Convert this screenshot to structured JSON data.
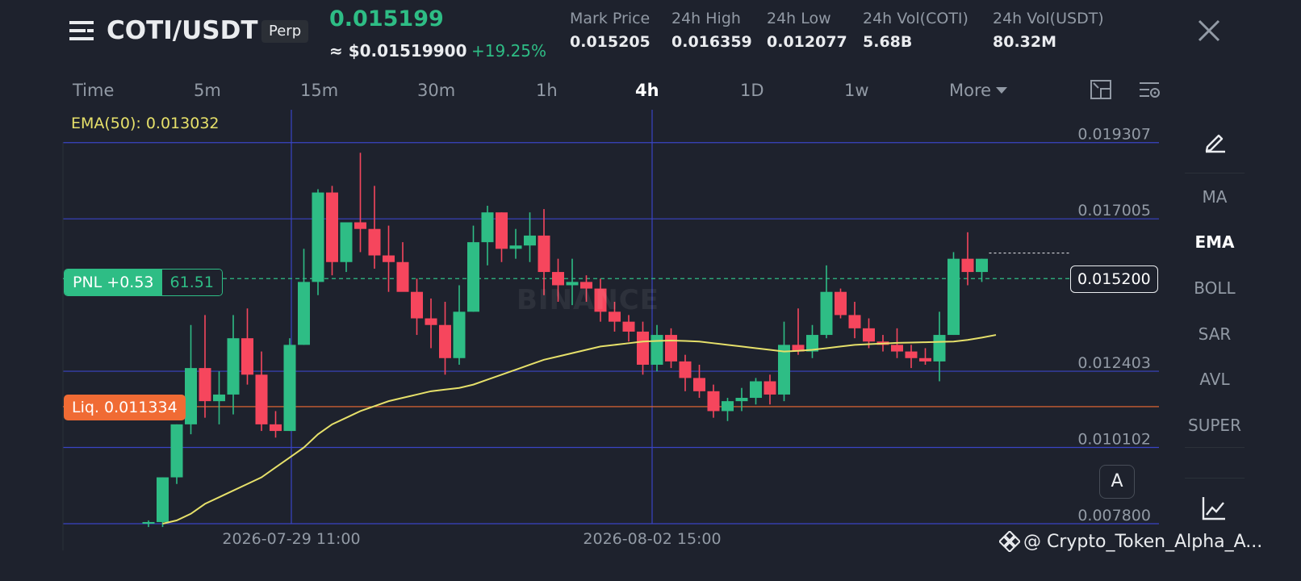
{
  "header": {
    "pair": "COTI/USDT",
    "badge": "Perp",
    "last_price": "0.015199",
    "usd_price": "≈ $0.01519900",
    "change_pct": "+19.25%",
    "stats": [
      {
        "label": "Mark Price",
        "value": "0.015205"
      },
      {
        "label": "24h High",
        "value": "0.016359"
      },
      {
        "label": "24h Low",
        "value": "0.012077"
      },
      {
        "label": "24h Vol(COTI)",
        "value": "5.68B"
      },
      {
        "label": "24h Vol(USDT)",
        "value": "80.32M"
      }
    ]
  },
  "timeframes": [
    "Time",
    "5m",
    "15m",
    "30m",
    "1h",
    "4h",
    "1D",
    "1w",
    "More"
  ],
  "active_timeframe": "4h",
  "indicator_label": "EMA(50): 0.013032",
  "pnl": {
    "label": "PNL +0.53",
    "value": "61.51"
  },
  "liquidation": "Liq. 0.011334",
  "current_price_tag": "0.015200",
  "watermark": "BINANCE",
  "auto_button": "A",
  "side_indicators": [
    "MA",
    "EMA",
    "BOLL",
    "SAR",
    "AVL",
    "SUPER"
  ],
  "active_indicator": "EMA",
  "footer": "@ Crypto_Token_Alpha_A...",
  "colors": {
    "up": "#2ebd85",
    "down": "#f6465d",
    "ema": "#e6e06a",
    "grid": "#3a44c4",
    "liq": "#f06b34",
    "background": "#1e222d"
  },
  "chart_data": {
    "type": "candlestick",
    "y_ticks": [
      "0.019307",
      "0.017005",
      "0.012403",
      "0.010102",
      "0.007800"
    ],
    "x_ticks": [
      "2026-07-29 11:00",
      "2026-08-02 15:00"
    ],
    "ylim": [
      0.0078,
      0.0193
    ],
    "candles": [
      {
        "o": 0.0078,
        "h": 0.0079,
        "l": 0.0077,
        "c": 0.00785
      },
      {
        "o": 0.00785,
        "h": 0.0092,
        "l": 0.0077,
        "c": 0.0092
      },
      {
        "o": 0.0092,
        "h": 0.0108,
        "l": 0.009,
        "c": 0.0108
      },
      {
        "o": 0.0108,
        "h": 0.0138,
        "l": 0.0105,
        "c": 0.0125
      },
      {
        "o": 0.0125,
        "h": 0.0141,
        "l": 0.011,
        "c": 0.0115
      },
      {
        "o": 0.0115,
        "h": 0.0124,
        "l": 0.0108,
        "c": 0.0117
      },
      {
        "o": 0.0117,
        "h": 0.0141,
        "l": 0.0111,
        "c": 0.0134
      },
      {
        "o": 0.0134,
        "h": 0.0143,
        "l": 0.012,
        "c": 0.0123
      },
      {
        "o": 0.0123,
        "h": 0.013,
        "l": 0.0106,
        "c": 0.0108
      },
      {
        "o": 0.0108,
        "h": 0.0112,
        "l": 0.0104,
        "c": 0.0106
      },
      {
        "o": 0.0106,
        "h": 0.0134,
        "l": 0.0106,
        "c": 0.0132
      },
      {
        "o": 0.0132,
        "h": 0.0161,
        "l": 0.0132,
        "c": 0.0151
      },
      {
        "o": 0.0151,
        "h": 0.0179,
        "l": 0.0147,
        "c": 0.0178
      },
      {
        "o": 0.0178,
        "h": 0.018,
        "l": 0.0153,
        "c": 0.0157
      },
      {
        "o": 0.0157,
        "h": 0.0169,
        "l": 0.0154,
        "c": 0.0169
      },
      {
        "o": 0.0169,
        "h": 0.019,
        "l": 0.016,
        "c": 0.0167
      },
      {
        "o": 0.0167,
        "h": 0.018,
        "l": 0.0155,
        "c": 0.0159
      },
      {
        "o": 0.0159,
        "h": 0.0168,
        "l": 0.0148,
        "c": 0.0157
      },
      {
        "o": 0.0157,
        "h": 0.0163,
        "l": 0.0149,
        "c": 0.0148
      },
      {
        "o": 0.0148,
        "h": 0.0152,
        "l": 0.0135,
        "c": 0.014
      },
      {
        "o": 0.014,
        "h": 0.0146,
        "l": 0.0131,
        "c": 0.0138
      },
      {
        "o": 0.0138,
        "h": 0.0145,
        "l": 0.0123,
        "c": 0.0128
      },
      {
        "o": 0.0128,
        "h": 0.015,
        "l": 0.0126,
        "c": 0.0142
      },
      {
        "o": 0.0142,
        "h": 0.0168,
        "l": 0.0142,
        "c": 0.0163
      },
      {
        "o": 0.0163,
        "h": 0.0174,
        "l": 0.0156,
        "c": 0.0172
      },
      {
        "o": 0.0172,
        "h": 0.0172,
        "l": 0.0157,
        "c": 0.0161
      },
      {
        "o": 0.0161,
        "h": 0.0167,
        "l": 0.0158,
        "c": 0.0162
      },
      {
        "o": 0.0162,
        "h": 0.0172,
        "l": 0.0157,
        "c": 0.0165
      },
      {
        "o": 0.0165,
        "h": 0.0173,
        "l": 0.0147,
        "c": 0.0154
      },
      {
        "o": 0.0154,
        "h": 0.0158,
        "l": 0.0145,
        "c": 0.015
      },
      {
        "o": 0.015,
        "h": 0.0158,
        "l": 0.0144,
        "c": 0.0151
      },
      {
        "o": 0.0151,
        "h": 0.0153,
        "l": 0.0145,
        "c": 0.0149
      },
      {
        "o": 0.0149,
        "h": 0.0152,
        "l": 0.0139,
        "c": 0.0142
      },
      {
        "o": 0.0142,
        "h": 0.0145,
        "l": 0.0136,
        "c": 0.0139
      },
      {
        "o": 0.0139,
        "h": 0.0141,
        "l": 0.0133,
        "c": 0.0136
      },
      {
        "o": 0.0136,
        "h": 0.0139,
        "l": 0.0123,
        "c": 0.0126
      },
      {
        "o": 0.0126,
        "h": 0.0138,
        "l": 0.0124,
        "c": 0.0135
      },
      {
        "o": 0.0135,
        "h": 0.0137,
        "l": 0.0125,
        "c": 0.0127
      },
      {
        "o": 0.0127,
        "h": 0.0129,
        "l": 0.0118,
        "c": 0.0122
      },
      {
        "o": 0.0122,
        "h": 0.0126,
        "l": 0.0116,
        "c": 0.0118
      },
      {
        "o": 0.0118,
        "h": 0.012,
        "l": 0.011,
        "c": 0.0112
      },
      {
        "o": 0.0112,
        "h": 0.0116,
        "l": 0.0109,
        "c": 0.0115
      },
      {
        "o": 0.0115,
        "h": 0.0119,
        "l": 0.0112,
        "c": 0.0116
      },
      {
        "o": 0.0116,
        "h": 0.0122,
        "l": 0.0114,
        "c": 0.0121
      },
      {
        "o": 0.0121,
        "h": 0.0123,
        "l": 0.0114,
        "c": 0.0117
      },
      {
        "o": 0.0117,
        "h": 0.0139,
        "l": 0.0115,
        "c": 0.0132
      },
      {
        "o": 0.0132,
        "h": 0.0143,
        "l": 0.0129,
        "c": 0.013
      },
      {
        "o": 0.013,
        "h": 0.0138,
        "l": 0.0128,
        "c": 0.0135
      },
      {
        "o": 0.0135,
        "h": 0.0156,
        "l": 0.0134,
        "c": 0.0148
      },
      {
        "o": 0.0148,
        "h": 0.0149,
        "l": 0.014,
        "c": 0.0141
      },
      {
        "o": 0.0141,
        "h": 0.0145,
        "l": 0.0134,
        "c": 0.0137
      },
      {
        "o": 0.0137,
        "h": 0.014,
        "l": 0.0131,
        "c": 0.0133
      },
      {
        "o": 0.0133,
        "h": 0.0135,
        "l": 0.013,
        "c": 0.0132
      },
      {
        "o": 0.0132,
        "h": 0.0137,
        "l": 0.0128,
        "c": 0.013
      },
      {
        "o": 0.013,
        "h": 0.0132,
        "l": 0.0125,
        "c": 0.0128
      },
      {
        "o": 0.0128,
        "h": 0.0131,
        "l": 0.0126,
        "c": 0.0127
      },
      {
        "o": 0.0127,
        "h": 0.0142,
        "l": 0.0121,
        "c": 0.0135
      },
      {
        "o": 0.0135,
        "h": 0.016,
        "l": 0.0135,
        "c": 0.0158
      },
      {
        "o": 0.0158,
        "h": 0.0166,
        "l": 0.015,
        "c": 0.0154
      },
      {
        "o": 0.0154,
        "h": 0.0158,
        "l": 0.0151,
        "c": 0.0158
      }
    ],
    "ema": [
      0.0078,
      0.0079,
      0.0081,
      0.0084,
      0.0086,
      0.0088,
      0.009,
      0.0092,
      0.0095,
      0.0098,
      0.0101,
      0.0105,
      0.0108,
      0.011,
      0.0112,
      0.01135,
      0.0115,
      0.0116,
      0.0117,
      0.0118,
      0.01185,
      0.0119,
      0.012,
      0.01215,
      0.0123,
      0.01245,
      0.0126,
      0.01275,
      0.01285,
      0.01295,
      0.01305,
      0.01315,
      0.0132,
      0.01325,
      0.0133,
      0.01332,
      0.01333,
      0.01332,
      0.0133,
      0.01325,
      0.0132,
      0.01315,
      0.0131,
      0.01305,
      0.013,
      0.01302,
      0.01305,
      0.0131,
      0.01315,
      0.0132,
      0.01322,
      0.01324,
      0.01326,
      0.01327,
      0.01328,
      0.01329,
      0.0133,
      0.01335,
      0.01342,
      0.0135
    ],
    "pnl_price": 0.0152,
    "liq_price": 0.011334
  }
}
